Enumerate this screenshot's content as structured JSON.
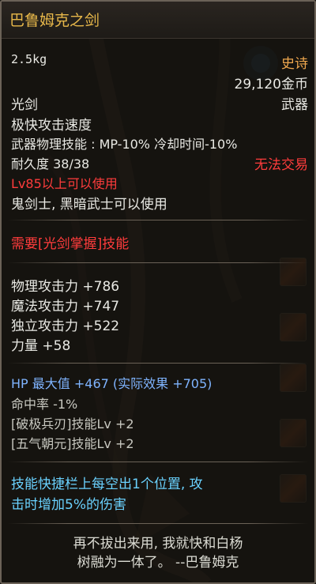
{
  "item": {
    "name": "巴鲁姆克之剑",
    "weight": "2.5kg",
    "rarity": "史诗",
    "price": "29,120金币",
    "type": "光剑",
    "category": "武器",
    "attack_speed": "极快攻击速度",
    "skill_effect": "武器物理技能 : MP-10% 冷却时间-10%",
    "durability": "耐久度 38/38",
    "trade_status": "无法交易",
    "level_req": "Lv85以上可以使用",
    "class_req": "鬼剑士, 黑暗武士可以使用",
    "skill_req": "需要[光剑掌握]技能",
    "stats": [
      "物理攻击力 +786",
      "魔法攻击力 +747",
      "独立攻击力 +522",
      "力量 +58"
    ],
    "hp_line": "HP 最大值 +467 (实际效果 +705)",
    "hit_rate": "命中率 -1%",
    "skill_bonus": [
      "[破极兵刃]技能Lv +2",
      "[五气朝元]技能Lv +2"
    ],
    "special_effect_lines": [
      "技能快捷栏上每空出1个位置, 攻",
      "击时增加5%的伤害"
    ],
    "flavor_lines": [
      "再不拔出来用, 我就快和白杨",
      "树融为一体了。 --巴鲁姆克"
    ]
  },
  "colors": {
    "title": "#e8b84a",
    "rarity": "#f0a84e",
    "warning": "#ff3c3c",
    "hp": "#7fb4ff",
    "special": "#6ad2ff"
  }
}
